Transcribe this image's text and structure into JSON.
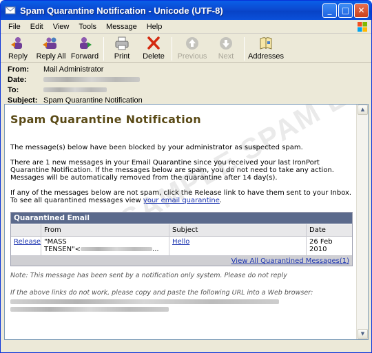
{
  "window": {
    "title": "Spam Quarantine Notification - Unicode (UTF-8)"
  },
  "menu": [
    "File",
    "Edit",
    "View",
    "Tools",
    "Message",
    "Help"
  ],
  "toolbar": {
    "reply": "Reply",
    "reply_all": "Reply All",
    "forward": "Forward",
    "print": "Print",
    "delete": "Delete",
    "previous": "Previous",
    "next": "Next",
    "addresses": "Addresses"
  },
  "headers": {
    "from_label": "From:",
    "from_value": "Mail Administrator",
    "date_label": "Date:",
    "to_label": "To:",
    "subject_label": "Subject:",
    "subject_value": "Spam Quarantine Notification"
  },
  "message": {
    "watermark": "SAMPLE SPAM EMAIL",
    "heading": "Spam Quarantine Notification",
    "p1": "The message(s) below have been blocked by your administrator as suspected spam.",
    "p2": "There are 1 new messages in your Email Quarantine since you received your last IronPort Quarantine Notification. If the messages below are spam, you do not need to take any action. Messages will be automatically removed from the quarantine after 14 day(s).",
    "p3_start": "If any of the messages below are not spam, click the Release link to have them sent to your Inbox. To see all quarantined messages view ",
    "p3_link": "your email quarantine",
    "p3_end": ".",
    "table": {
      "title": "Quarantined Email",
      "col_from": "From",
      "col_subject": "Subject",
      "col_date": "Date",
      "row_release": "Release",
      "row_from_line1": "\"MASS",
      "row_from_line2": "TENSEN\"<",
      "row_from_trail": "...",
      "row_subject": "Hello",
      "row_date": "26 Feb 2010",
      "view_all": "View All Quarantined Messages(1)"
    },
    "note1": "Note: This message has been sent by a notification only system. Please do not reply",
    "note2": "If the above links do not work, please copy and paste the following URL into a Web browser:"
  }
}
